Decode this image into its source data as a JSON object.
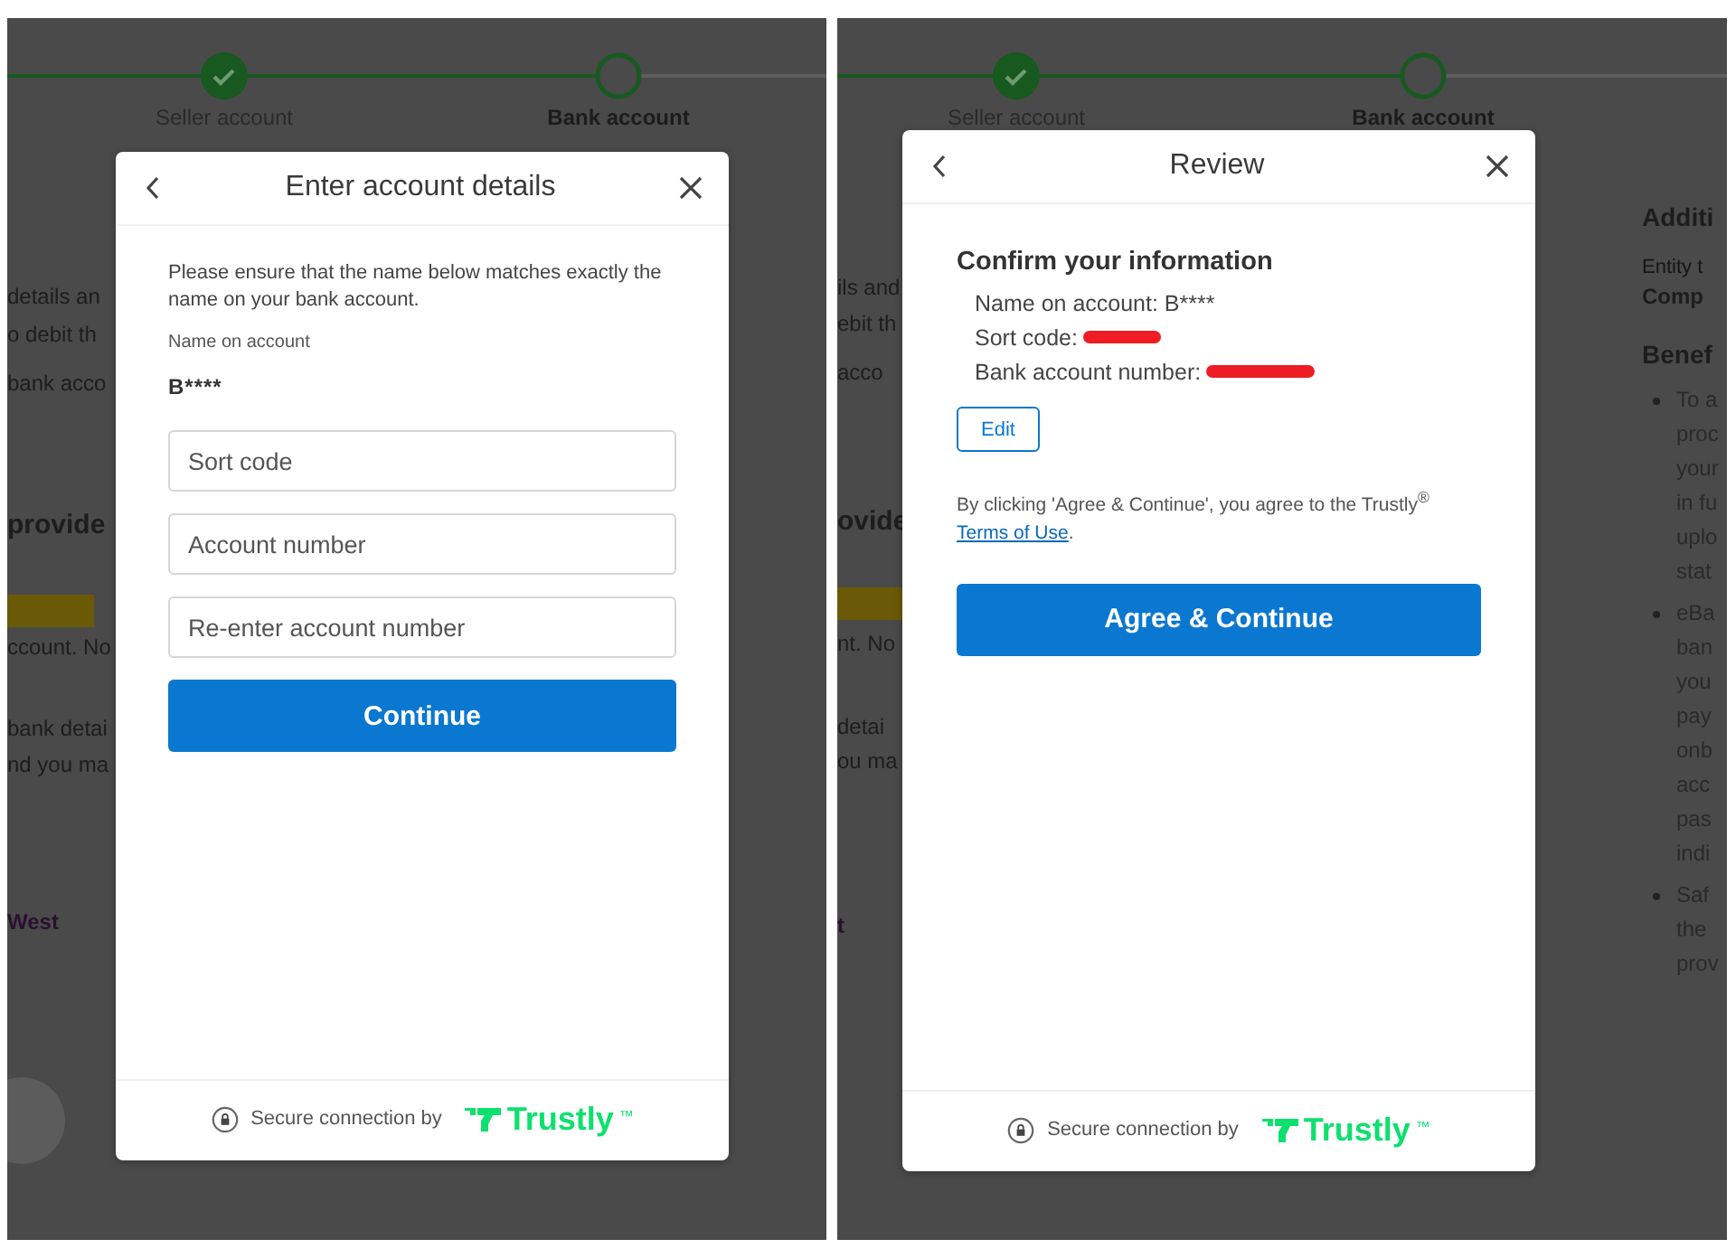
{
  "panels": [
    {
      "stepper": {
        "steps": [
          {
            "label": "Seller account",
            "done": true,
            "current": false
          },
          {
            "label": "Bank account",
            "done": false,
            "current": true
          }
        ]
      },
      "background_text": [
        {
          "kind": "text",
          "text": "details an"
        },
        {
          "kind": "text",
          "text": "o debit th"
        },
        {
          "kind": "text",
          "text": "bank acco"
        },
        {
          "kind": "heading",
          "text": "provide"
        },
        {
          "kind": "tag"
        },
        {
          "kind": "text",
          "text": "ccount. No"
        },
        {
          "kind": "text",
          "text": "bank detai"
        },
        {
          "kind": "text",
          "text": "nd you ma"
        },
        {
          "kind": "link",
          "text": "West"
        },
        {
          "kind": "avatar"
        }
      ],
      "dialog": {
        "kind": "account_form",
        "title": "Enter account details",
        "intro": "Please ensure that the name below matches exactly the name on your bank account.",
        "name_label": "Name on account",
        "name_value": "B****",
        "fields": [
          {
            "placeholder": "Sort code"
          },
          {
            "placeholder": "Account number"
          },
          {
            "placeholder": "Re-enter account number"
          }
        ],
        "primary_button": "Continue",
        "footer": {
          "text": "Secure connection by",
          "brand": "Trustly",
          "trademark": "™"
        }
      }
    },
    {
      "stepper": {
        "steps": [
          {
            "label": "Seller account",
            "done": true,
            "current": false
          },
          {
            "label": "Bank account",
            "done": false,
            "current": true
          }
        ]
      },
      "background_text": [
        {
          "kind": "text",
          "text": "ils and"
        },
        {
          "kind": "text",
          "text": "ebit th"
        },
        {
          "kind": "text",
          "text": "acco"
        },
        {
          "kind": "heading",
          "text": "ovide"
        },
        {
          "kind": "tag"
        },
        {
          "kind": "text",
          "text": "nt. No"
        },
        {
          "kind": "text",
          "text": "detai"
        },
        {
          "kind": "text",
          "text": "ou ma"
        },
        {
          "kind": "link",
          "text": "t"
        }
      ],
      "side_column": [
        {
          "kind": "heading",
          "text": "Additi"
        },
        {
          "kind": "caption",
          "text": "Entity t"
        },
        {
          "kind": "strong",
          "text": "Comp"
        },
        {
          "kind": "heading",
          "text": "Benef"
        },
        {
          "kind": "bullet",
          "lines": [
            "To a",
            "proc",
            "your",
            "in fu",
            "uplo",
            "stat"
          ]
        },
        {
          "kind": "bullet",
          "lines": [
            "eBa",
            "ban",
            "you",
            "pay",
            "onb",
            "acc",
            "pas",
            "indi"
          ]
        },
        {
          "kind": "bullet",
          "lines": [
            "Saf",
            "the",
            "prov"
          ]
        }
      ],
      "dialog": {
        "kind": "review",
        "title": "Review",
        "heading": "Confirm your information",
        "lines": [
          {
            "text": "Name on account: B****",
            "redacted": false
          },
          {
            "text": "Sort code:",
            "redacted": true
          },
          {
            "text": "Bank account number:",
            "redacted": true
          }
        ],
        "edit_button": "Edit",
        "consent": "By clicking 'Agree & Continue', you agree to the Trustly$^{®}$",
        "consent_link": "Terms of Use",
        "consent_end": ".",
        "primary_button": "Agree & Continue",
        "footer": {
          "text": "Secure connection by",
          "brand": "Trustly",
          "trademark": "™"
        }
      }
    }
  ]
}
